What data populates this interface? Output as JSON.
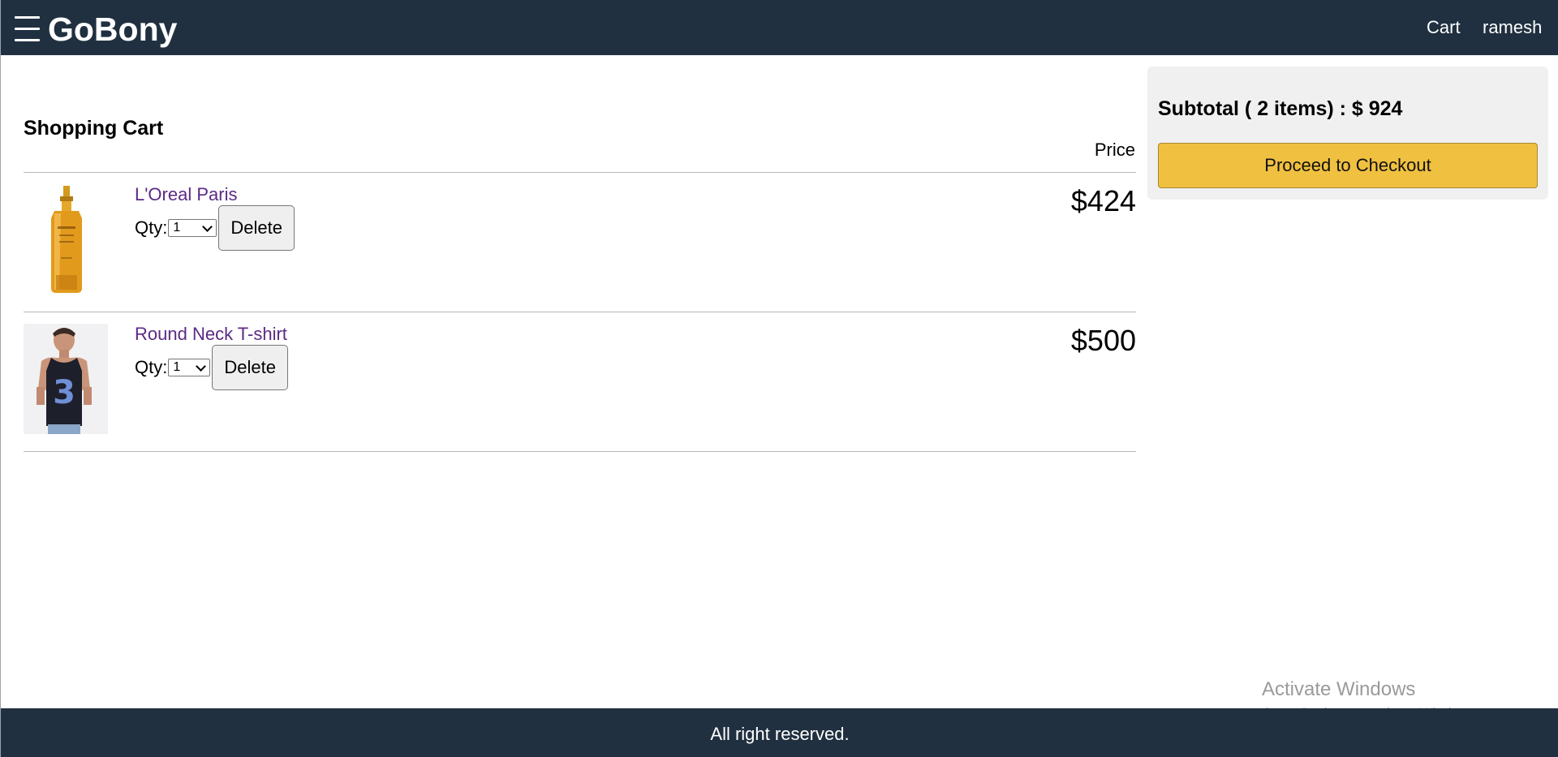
{
  "header": {
    "brand": "GoBony",
    "nav": {
      "cart_label": "Cart",
      "user_label": "ramesh"
    }
  },
  "cart": {
    "title": "Shopping Cart",
    "price_header": "Price",
    "qty_label": "Qty:",
    "delete_label": "Delete",
    "items": [
      {
        "name": "L'Oreal Paris",
        "qty": "1",
        "price": "$424",
        "image": "serum-bottle-image"
      },
      {
        "name": "Round Neck T-shirt",
        "qty": "1",
        "price": "$500",
        "image": "tank-top-model-image"
      }
    ]
  },
  "summary": {
    "subtotal_text": "Subtotal ( 2 items) : $ 924",
    "checkout_label": "Proceed to Checkout"
  },
  "watermark": {
    "title": "Activate Windows",
    "subtitle": "Go to Settings to activate Windows."
  },
  "footer": {
    "text": "All right reserved."
  },
  "colors": {
    "header_bg": "#203040",
    "link": "#5b2a86",
    "checkout_bg": "#f0c040",
    "panel_bg": "#f0f0f0"
  }
}
